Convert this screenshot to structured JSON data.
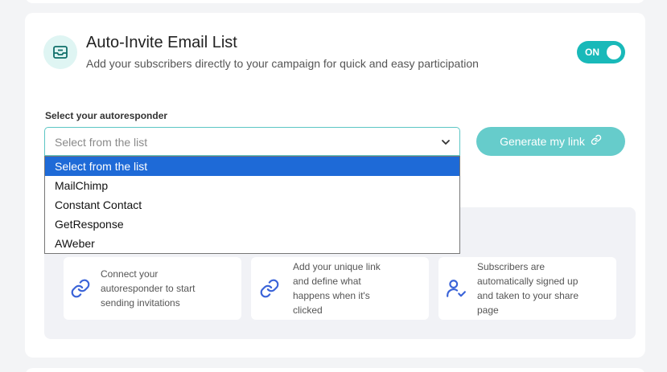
{
  "section": {
    "title": "Auto-Invite Email List",
    "subtitle": "Add your subscribers directly to your campaign for quick and easy participation",
    "icon": "inbox-icon",
    "toggle_label": "ON"
  },
  "form": {
    "label": "Select your autoresponder",
    "placeholder": "Select from the list",
    "button_label": "Generate my link",
    "button_icon": "link-icon"
  },
  "dropdown": {
    "options": [
      "Select from the list",
      "MailChimp",
      "Constant Contact",
      "GetResponse",
      "AWeber"
    ],
    "selected_index": 0
  },
  "steps": [
    {
      "icon": "link-icon",
      "text": "Connect your\nautoresponder to start\nsending invitations"
    },
    {
      "icon": "link-icon",
      "text": "Add your unique link\nand define what\nhappens when it's\nclicked"
    },
    {
      "icon": "user-check-icon",
      "text": "Subscribers are\nautomatically signed up\nand taken to your share\npage"
    }
  ],
  "colors": {
    "accent": "#19b9b9",
    "button": "#66cccb",
    "selected_option": "#1e6ad7",
    "icon_blue": "#3a63d8"
  }
}
